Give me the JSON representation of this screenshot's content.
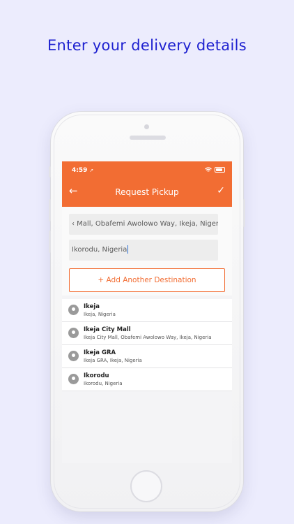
{
  "headline": "Enter your delivery details",
  "status_bar": {
    "time": "4:59"
  },
  "app_bar": {
    "title": "Request Pickup",
    "back_icon": "arrow-left-icon",
    "confirm_icon": "check-icon"
  },
  "form": {
    "pickup_value": "‹ Mall, Obafemi Awolowo Way, Ikeja, Nigeria",
    "destination_value": "Ikorodu, Nigeria",
    "add_destination_label": "+ Add Another Destination"
  },
  "suggestions": [
    {
      "title": "Ikeja",
      "subtitle": "Ikeja, Nigeria"
    },
    {
      "title": "Ikeja City Mall",
      "subtitle": "Ikeja City Mall, Obafemi Awolowo Way, Ikeja, Nigeria"
    },
    {
      "title": "Ikeja GRA",
      "subtitle": "Ikeja GRA, Ikeja, Nigeria"
    },
    {
      "title": "Ikorodu",
      "subtitle": "Ikorodu, Nigeria"
    }
  ],
  "colors": {
    "accent": "#f26d33",
    "headline": "#1e21d0",
    "background": "#ececfd"
  }
}
